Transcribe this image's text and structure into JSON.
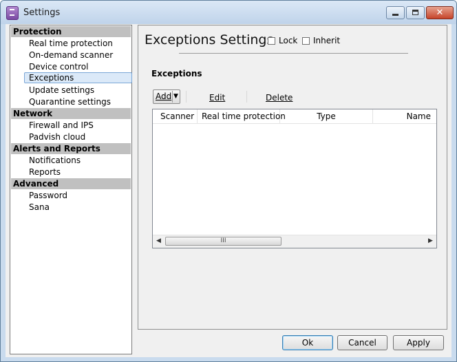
{
  "window": {
    "title": "Settings"
  },
  "sidebar": {
    "groups": [
      {
        "label": "Protection",
        "items": [
          {
            "label": "Real time protection"
          },
          {
            "label": "On-demand scanner"
          },
          {
            "label": "Device control"
          },
          {
            "label": "Exceptions",
            "selected": true
          },
          {
            "label": "Update settings"
          },
          {
            "label": "Quarantine settings"
          }
        ]
      },
      {
        "label": "Network",
        "items": [
          {
            "label": "Firewall and IPS"
          },
          {
            "label": "Padvish cloud"
          }
        ]
      },
      {
        "label": "Alerts and Reports",
        "items": [
          {
            "label": "Notifications"
          },
          {
            "label": "Reports"
          }
        ]
      },
      {
        "label": "Advanced",
        "items": [
          {
            "label": "Password"
          },
          {
            "label": "Sana"
          }
        ]
      }
    ]
  },
  "main": {
    "title": "Exceptions Settings",
    "lock": {
      "label": "Lock",
      "checked": false
    },
    "inherit": {
      "label": "Inherit",
      "checked": false
    },
    "section_title": "Exceptions",
    "toolbar": {
      "add": "Add",
      "edit": "Edit",
      "delete": "Delete"
    },
    "table": {
      "columns": [
        "Scanner",
        "Real time protection",
        "Type",
        "Name"
      ],
      "rows": [],
      "scroll_thumb_glyph": "III"
    }
  },
  "footer": {
    "ok": "Ok",
    "cancel": "Cancel",
    "apply": "Apply"
  },
  "icons": {
    "app": "settings-app-icon",
    "minimize": "minimize-icon",
    "maximize": "maximize-icon",
    "close": "close-icon"
  },
  "colors": {
    "title_bar": "#c9dbee",
    "close_button": "#c6442a",
    "selected_item": "#dbe9f8",
    "group_header": "#c0c0c0"
  }
}
